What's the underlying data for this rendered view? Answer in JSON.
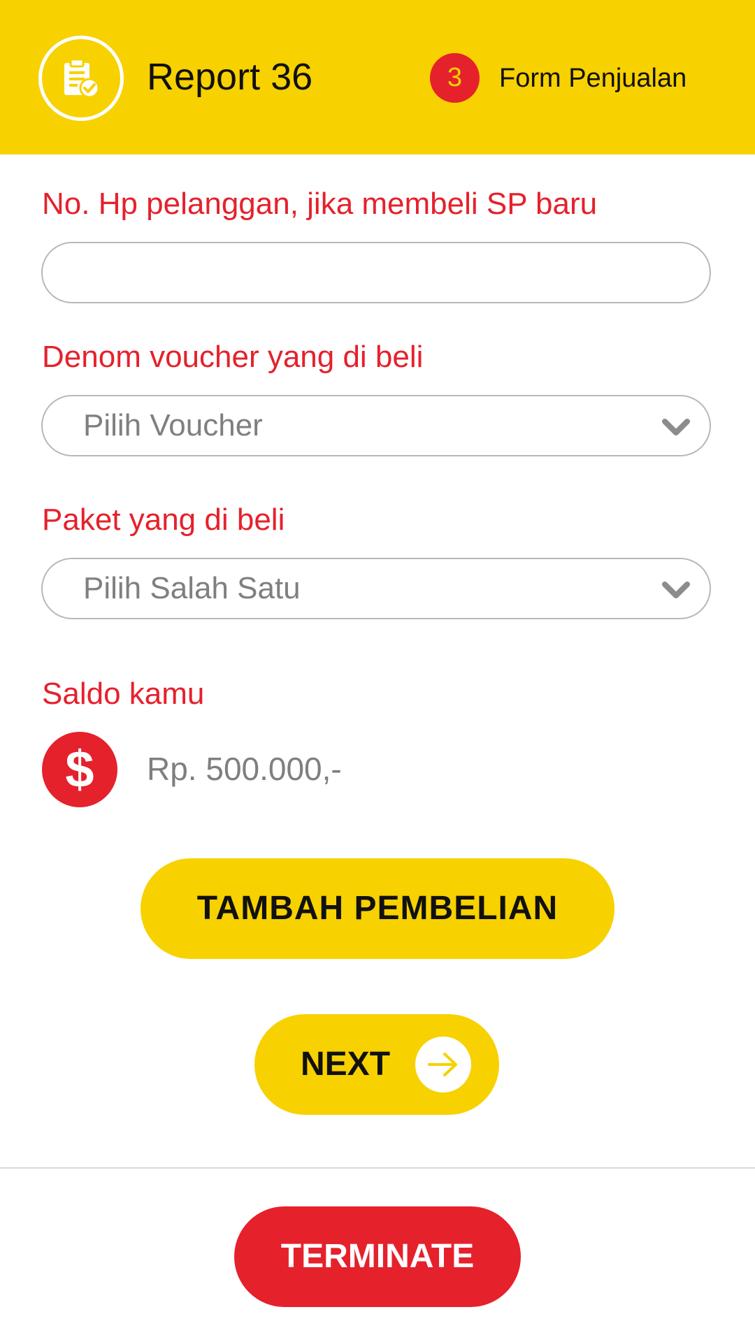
{
  "header": {
    "title": "Report 36",
    "icon": "report-check-icon",
    "step": {
      "number": "3",
      "label": "Form Penjualan"
    }
  },
  "form": {
    "phone": {
      "label": "No. Hp pelanggan, jika membeli SP baru",
      "value": ""
    },
    "voucher": {
      "label": "Denom voucher yang di beli",
      "selected": "Pilih Voucher"
    },
    "package": {
      "label": "Paket yang di beli",
      "selected": "Pilih Salah Satu"
    },
    "balance": {
      "label": "Saldo kamu",
      "icon_text": "$",
      "value": "Rp. 500.000,-"
    }
  },
  "actions": {
    "add_label": "TAMBAH PEMBELIAN",
    "next_label": "NEXT",
    "terminate_label": "TERMINATE"
  },
  "colors": {
    "accent_yellow": "#F7D100",
    "accent_red": "#E5212C",
    "placeholder_gray": "#7F7F7F"
  }
}
